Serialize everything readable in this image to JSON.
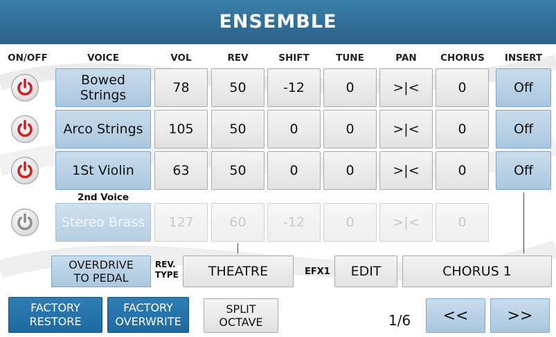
{
  "title": "ENSEMBLE",
  "columns": {
    "onoff": "ON/OFF",
    "voice": "VOICE",
    "vol": "VOL",
    "rev": "REV",
    "shift": "SHIFT",
    "tune": "TUNE",
    "pan": "PAN",
    "chorus": "CHORUS",
    "insert": "INSERT"
  },
  "rows": [
    {
      "power": "on",
      "voice": "Bowed Strings",
      "vol": "78",
      "rev": "50",
      "shift": "-12",
      "tune": "0",
      "pan": ">|<",
      "chorus": "0",
      "insert": "Off"
    },
    {
      "power": "on",
      "voice": "Arco Strings",
      "vol": "105",
      "rev": "50",
      "shift": "0",
      "tune": "0",
      "pan": ">|<",
      "chorus": "0",
      "insert": "Off"
    },
    {
      "power": "on",
      "voice": "1St Violin",
      "vol": "63",
      "rev": "50",
      "shift": "0",
      "tune": "0",
      "pan": ">|<",
      "chorus": "0",
      "insert": "Off"
    },
    {
      "power": "off",
      "voice": "Stereo Brass",
      "vol": "127",
      "rev": "60",
      "shift": "-12",
      "tune": "0",
      "pan": ">|<",
      "chorus": "0"
    }
  ],
  "second_voice_label": "2nd Voice",
  "overdrive": {
    "line1": "OVERDRIVE",
    "line2": "TO PEDAL"
  },
  "rev_type": {
    "label_line1": "REV.",
    "label_line2": "TYPE",
    "value": "THEATRE"
  },
  "efx": {
    "label": "EFX1",
    "edit": "EDIT",
    "value": "CHORUS 1"
  },
  "footer": {
    "factory_restore": {
      "line1": "FACTORY",
      "line2": "RESTORE"
    },
    "factory_overwrite": {
      "line1": "FACTORY",
      "line2": "OVERWRITE"
    },
    "split_octave": {
      "line1": "SPLIT",
      "line2": "OCTAVE"
    },
    "page": "1/6",
    "prev": "<<",
    "next": ">>"
  },
  "colors": {
    "title_bar": "#2f6d95",
    "power_on": "#d21f1f",
    "power_off": "#8c8c8c",
    "dark_button": "#2372ad"
  }
}
